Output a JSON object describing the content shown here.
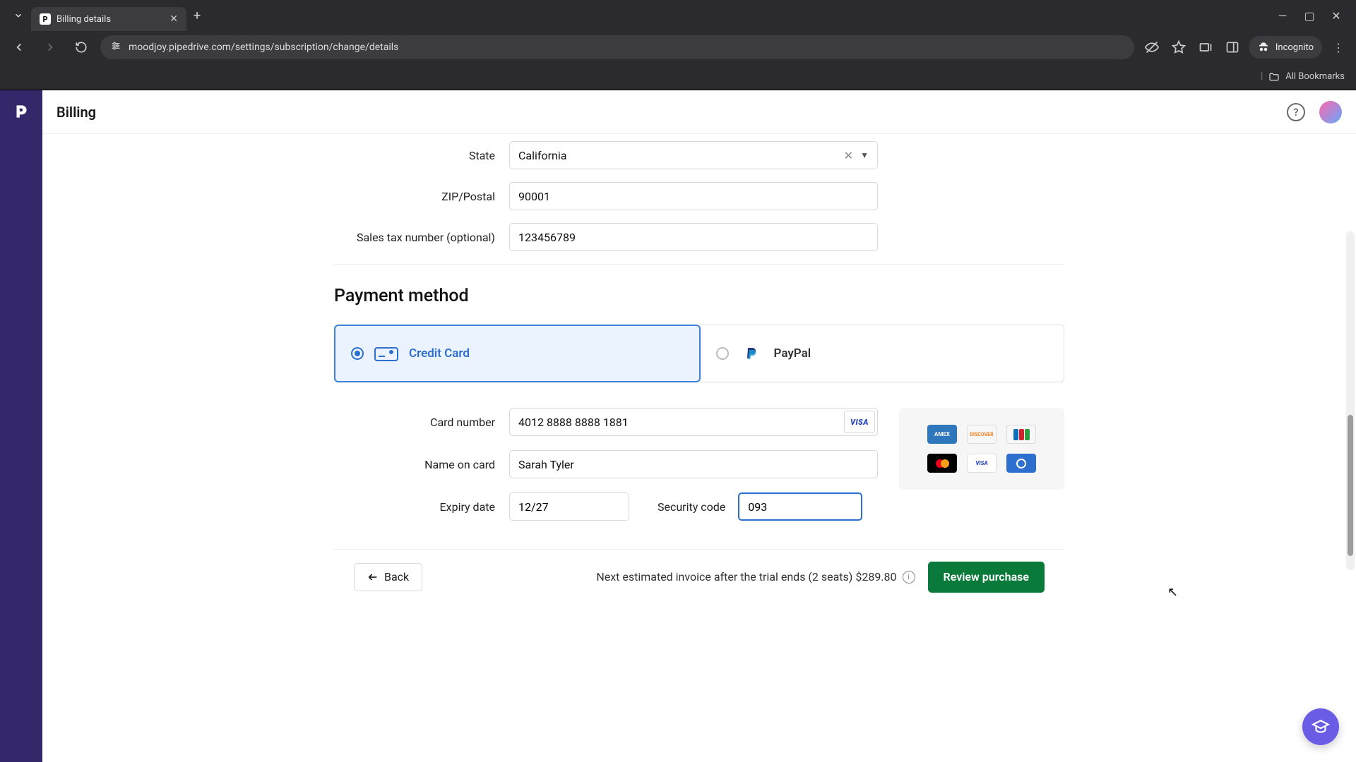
{
  "browser": {
    "tab_title": "Billing details",
    "url": "moodjoy.pipedrive.com/settings/subscription/change/details",
    "incognito_label": "Incognito",
    "all_bookmarks": "All Bookmarks"
  },
  "header": {
    "title": "Billing"
  },
  "form": {
    "state_label": "State",
    "state_value": "California",
    "zip_label": "ZIP/Postal",
    "zip_value": "90001",
    "tax_label": "Sales tax number (optional)",
    "tax_value": "123456789"
  },
  "payment": {
    "section_title": "Payment method",
    "credit_card_label": "Credit Card",
    "paypal_label": "PayPal",
    "card_number_label": "Card number",
    "card_number_value": "4012 8888 8888 1881",
    "card_brand": "VISA",
    "name_label": "Name on card",
    "name_value": "Sarah Tyler",
    "expiry_label": "Expiry date",
    "expiry_value": "12/27",
    "cvv_label": "Security code",
    "cvv_value": "093"
  },
  "footer": {
    "back_label": "Back",
    "estimate_text": "Next estimated invoice after the trial ends (2 seats) $289.80",
    "review_label": "Review purchase"
  },
  "card_brands": [
    "AMEX",
    "DISCOVER",
    "JCB",
    "mastercard",
    "VISA",
    "Diners"
  ]
}
